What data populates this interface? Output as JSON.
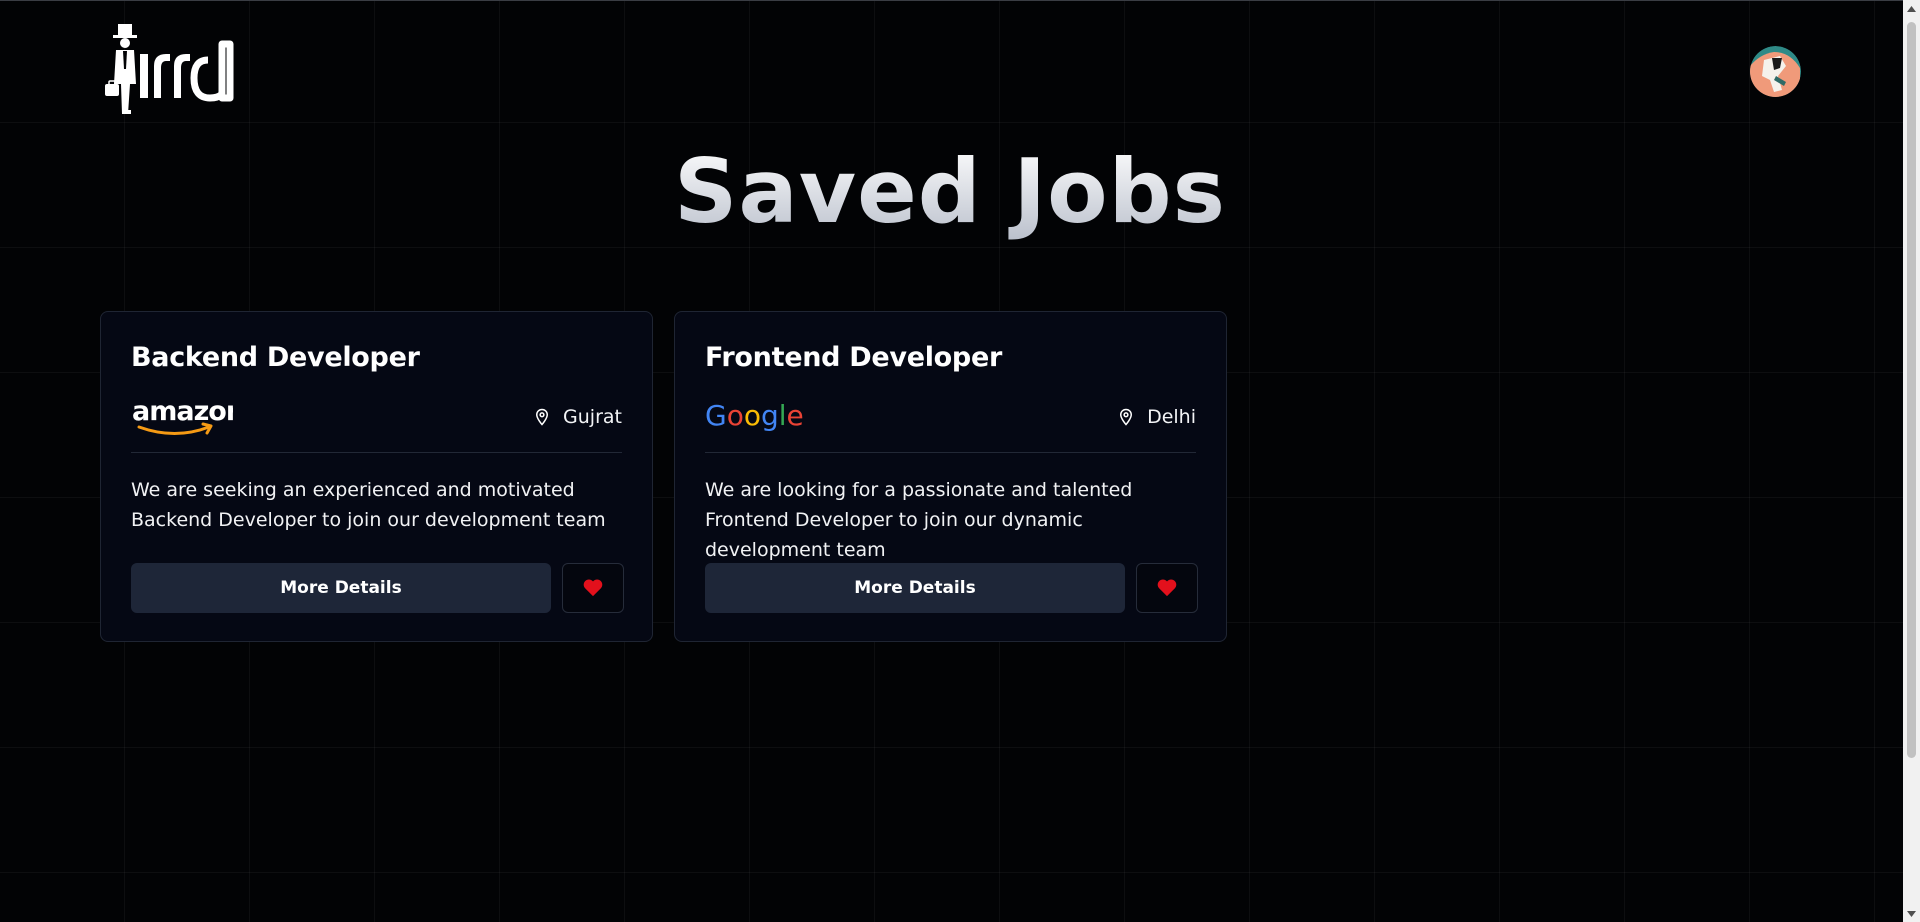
{
  "header": {
    "logo_text": "Hirrd",
    "avatar_icon": "user-avatar"
  },
  "page": {
    "title": "Saved Jobs"
  },
  "jobs": [
    {
      "title": "Backend Developer",
      "company": "amazon",
      "company_icon": "amazon-logo",
      "location": "Gujrat",
      "description": "We are seeking an experienced and motivated Backend Developer to join our development team",
      "details_label": "More Details",
      "saved": true
    },
    {
      "title": "Frontend Developer",
      "company": "Google",
      "company_icon": "google-logo",
      "location": "Delhi",
      "description": "We are looking for a passionate and talented Frontend Developer to join our dynamic development team",
      "details_label": "More Details",
      "saved": true
    }
  ],
  "colors": {
    "background": "#020305",
    "card": "#050814",
    "button": "#1e2638",
    "heart": "#e3101c",
    "amazon_smile": "#f59a14"
  }
}
